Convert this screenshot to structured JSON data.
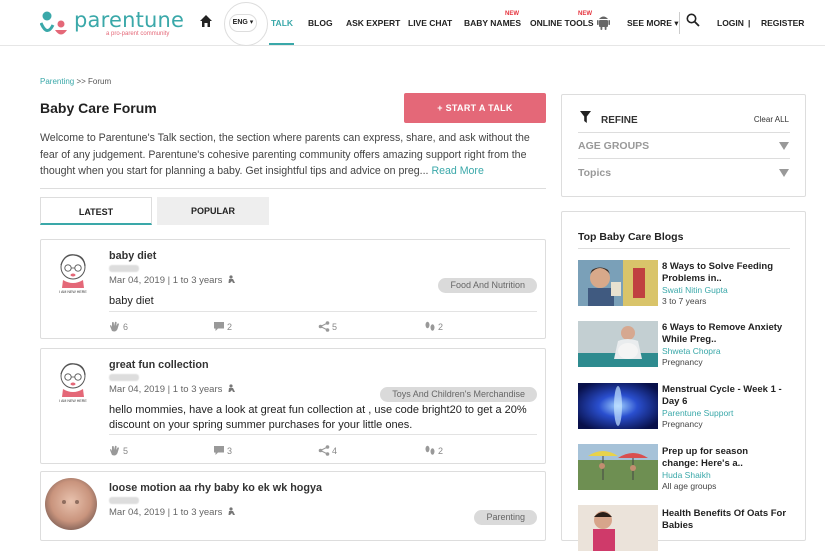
{
  "header": {
    "logo_text": "parentune",
    "logo_sub": "a pro-parent community",
    "lang": "ENG ▾",
    "nav": [
      {
        "label": "TALK",
        "active": true
      },
      {
        "label": "BLOG"
      },
      {
        "label": "ASK EXPERT"
      },
      {
        "label": "LIVE CHAT"
      },
      {
        "label": "BABY NAMES",
        "badge": "NEW"
      },
      {
        "label": "ONLINE TOOLS",
        "badge": "NEW"
      },
      {
        "label": "SEE MORE ▾"
      }
    ],
    "login": "LOGIN",
    "separator": "|",
    "register": "REGISTER"
  },
  "breadcrumb": {
    "link": "Parenting",
    "sep": " >> ",
    "current": "Forum"
  },
  "page": {
    "title": "Baby Care Forum",
    "start_talk": "+ START A TALK",
    "intro": "Welcome to Parentune's Talk section, the section where parents can express, share, and ask without the fear of any judgement. Parentune's cohesive parenting community offers amazing support right from the thought when you start for planning a baby. Get insightful tips and advice on preg... ",
    "read_more": "Read More"
  },
  "tabs": {
    "latest": "LATEST",
    "popular": "POPULAR"
  },
  "posts": [
    {
      "title": "baby diet",
      "meta": "Mar 04, 2019 | 1 to 3 years",
      "tag": "Food And Nutrition",
      "body": "baby diet",
      "stats": {
        "hands": "6",
        "comments": "2",
        "shares": "5",
        "feet": "2"
      }
    },
    {
      "title": "great fun collection",
      "meta": "Mar 04, 2019 | 1 to 3 years",
      "tag": "Toys And Children's Merchandise",
      "body": "hello mommies, have a look at great fun collection at , use code bright20 to get a 20% discount on your spring summer purchases for your little ones.",
      "stats": {
        "hands": "5",
        "comments": "3",
        "shares": "4",
        "feet": "2"
      }
    },
    {
      "title": "loose motion aa rhy baby ko ek wk hogya",
      "meta": "Mar 04, 2019 | 1 to 3 years",
      "tag": "Parenting"
    }
  ],
  "refine": {
    "title": "REFINE",
    "clear": "Clear ALL",
    "rows": [
      "AGE GROUPS",
      "Topics"
    ]
  },
  "blogs": {
    "title": "Top Baby Care Blogs",
    "items": [
      {
        "title": "8 Ways to Solve Feeding Problems in..",
        "author": "Swati Nitin Gupta",
        "age": "3 to 7 years"
      },
      {
        "title": "6 Ways to Remove Anxiety While Preg..",
        "author": "Shweta Chopra",
        "age": "Pregnancy"
      },
      {
        "title": "Menstrual Cycle - Week 1 - Day 6",
        "author": "Parentune Support",
        "age": "Pregnancy"
      },
      {
        "title": "Prep up for season change: Here's a..",
        "author": "Huda Shaikh",
        "age": "All age groups"
      },
      {
        "title": "Health Benefits Of Oats For Babies",
        "author": "",
        "age": ""
      }
    ]
  }
}
